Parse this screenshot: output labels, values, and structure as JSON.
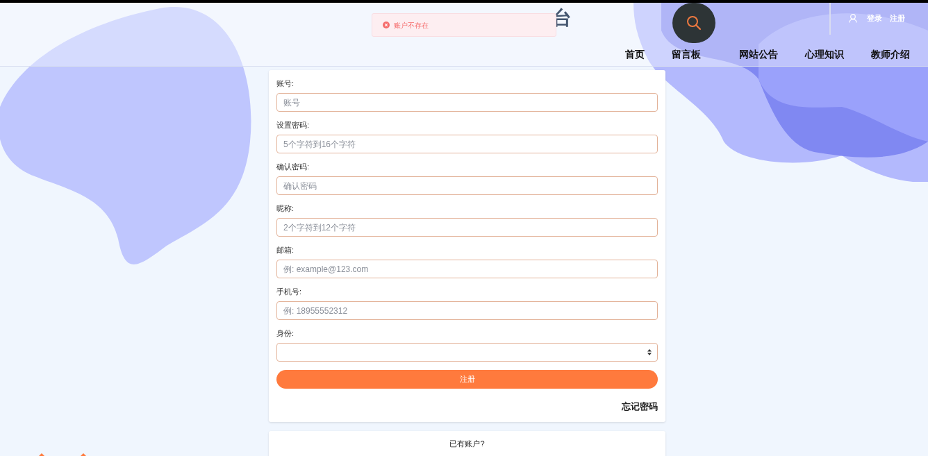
{
  "header": {
    "title_visible": "台",
    "auth_links": [
      {
        "label": "登录"
      },
      {
        "label": "注册"
      }
    ],
    "nav": [
      {
        "label": "首页"
      },
      {
        "label": "留言板"
      },
      {
        "label": "网站公告"
      },
      {
        "label": "心理知识"
      },
      {
        "label": "教师介绍"
      }
    ]
  },
  "toast": {
    "kind": "error",
    "message": "账户不存在"
  },
  "form": {
    "fields": [
      {
        "kind": "text",
        "label": "账号:",
        "placeholder": "账号"
      },
      {
        "kind": "text",
        "label": "设置密码:",
        "placeholder": "5个字符到16个字符"
      },
      {
        "kind": "text",
        "label": "确认密码:",
        "placeholder": "确认密码"
      },
      {
        "kind": "text",
        "label": "昵称:",
        "placeholder": "2个字符到12个字符"
      },
      {
        "kind": "text",
        "label": "邮箱:",
        "placeholder": "例: example@123.com"
      },
      {
        "kind": "text",
        "label": "手机号:",
        "placeholder": "例: 18955552312"
      },
      {
        "kind": "select",
        "label": "身份:"
      }
    ],
    "submit": "注册",
    "forgot": "忘记密码"
  },
  "login_card": {
    "text": "已有账户?"
  }
}
